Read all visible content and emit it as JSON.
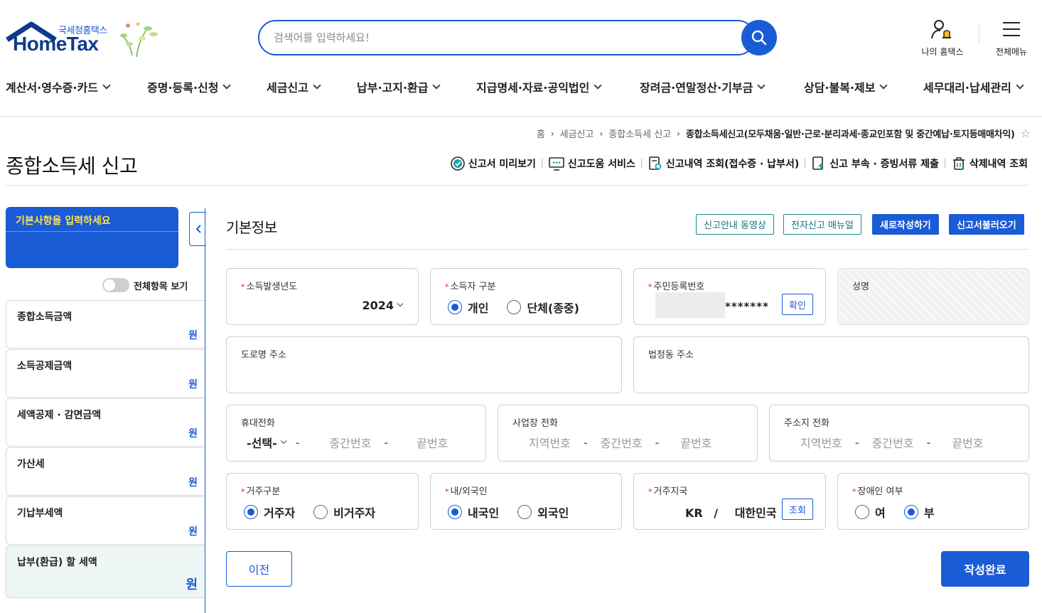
{
  "header": {
    "logo_sub": "국세청홈택스",
    "logo_main": "HomeTax",
    "search_placeholder": "검색어를 입력하세요!",
    "my_hometax": "나의 홈택스",
    "all_menu": "전체메뉴"
  },
  "gnb": [
    {
      "label": "계산서·영수증·카드"
    },
    {
      "label": "증명·등록·신청"
    },
    {
      "label": "세금신고"
    },
    {
      "label": "납부·고지·환급"
    },
    {
      "label": "지급명세·자료·공익법인"
    },
    {
      "label": "장려금·연말정산·기부금"
    },
    {
      "label": "상담·불복·제보"
    },
    {
      "label": "세무대리·납세관리"
    }
  ],
  "breadcrumb": {
    "home": "홈",
    "level1": "세금신고",
    "level2": "종합소득세 신고",
    "current": "종합소득세신고(모두채움·일반·근로·분리과세·종교인포함 및 중간예납·토지등매매차익)"
  },
  "page_title": "종합소득세 신고",
  "tools": [
    {
      "label": "신고서 미리보기"
    },
    {
      "label": "신고도움 서비스"
    },
    {
      "label": "신고내역 조회(접수증 · 납부서)"
    },
    {
      "label": "신고 부속 · 증빙서류 제출"
    },
    {
      "label": "삭제내역 조회"
    }
  ],
  "left": {
    "banner": "기본사항을 입력하세요",
    "toggle_label": "전체항목 보기",
    "unit": "원",
    "items": [
      {
        "label": "종합소득금액"
      },
      {
        "label": "소득공제금액"
      },
      {
        "label": "세액공제 · 감면금액"
      },
      {
        "label": "가산세"
      },
      {
        "label": "기납부세액"
      },
      {
        "label": "납부(환급) 할 세액"
      }
    ]
  },
  "main": {
    "section_title": "기본정보",
    "buttons": {
      "guide_video": "신고안내 동영상",
      "manual": "전자신고 매뉴얼",
      "new": "새로작성하기",
      "load": "신고서불러오기"
    },
    "required_mark": "*",
    "year": {
      "label": "소득발생년도",
      "value": "2024"
    },
    "filer_type": {
      "label": "소득자 구분",
      "options": [
        "개인",
        "단체(종중)"
      ],
      "selected": "개인"
    },
    "rrn": {
      "label": "주민등록번호",
      "masked": "*******",
      "confirm": "확인"
    },
    "name": {
      "label": "성명"
    },
    "road_address": {
      "label": "도로명 주소"
    },
    "legal_address": {
      "label": "법정동 주소"
    },
    "mobile": {
      "label": "휴대전화",
      "select": "-선택-",
      "mid": "중간번호",
      "last": "끝번호"
    },
    "work_phone": {
      "label": "사업장 전화",
      "area": "지역번호",
      "mid": "중간번호",
      "last": "끝번호"
    },
    "home_phone": {
      "label": "주소지 전화",
      "area": "지역번호",
      "mid": "중간번호",
      "last": "끝번호"
    },
    "residence": {
      "label": "거주구분",
      "options": [
        "거주자",
        "비거주자"
      ],
      "selected": "거주자"
    },
    "nationality": {
      "label": "내/외국인",
      "options": [
        "내국인",
        "외국인"
      ],
      "selected": "내국인"
    },
    "country": {
      "label": "거주지국",
      "code": "KR",
      "slash": "/",
      "name": "대한민국",
      "lookup": "조회"
    },
    "disability": {
      "label": "장애인 여부",
      "options": [
        "여",
        "부"
      ],
      "selected": "부"
    },
    "prev": "이전",
    "done": "작성완료"
  },
  "colors": {
    "primary": "#1a5bd6",
    "teal": "#1a8a8a",
    "banner_text": "#ffe14d",
    "required": "#d92020"
  }
}
